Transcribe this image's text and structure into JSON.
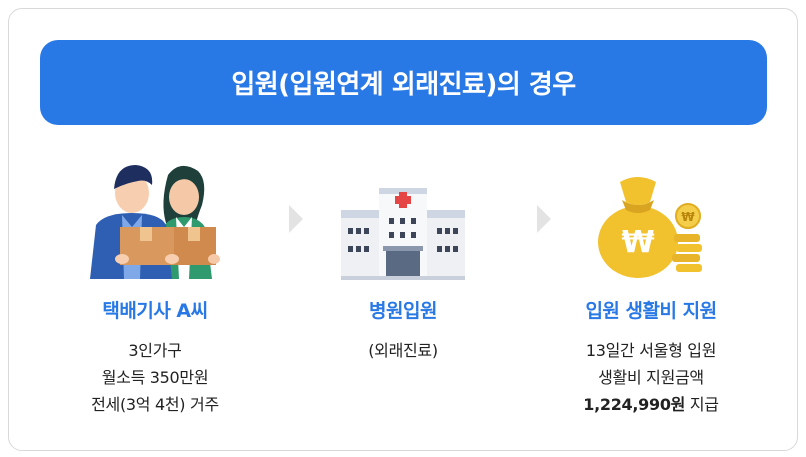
{
  "banner": {
    "title": "입원(입원연계 외래진료)의 경우"
  },
  "steps": [
    {
      "title": "택배기사 A씨",
      "lines": [
        "3인가구",
        "월소득 350만원",
        "전세(3억 4천) 거주"
      ]
    },
    {
      "title": "병원입원",
      "lines": [
        "(외래진료)"
      ]
    },
    {
      "title": "입원 생활비 지원",
      "lines": [
        "13일간 서울형 입원",
        "생활비 지원금액"
      ],
      "amount": "1,224,990원",
      "amount_suffix": " 지급"
    }
  ],
  "icons": [
    "delivery-workers-illustration",
    "hospital-icon",
    "money-bag-icon",
    "arrow-right-icon"
  ],
  "colors": {
    "accent": "#2878e6",
    "banner_text": "#ffffff",
    "arrow": "#e3e3e3"
  }
}
